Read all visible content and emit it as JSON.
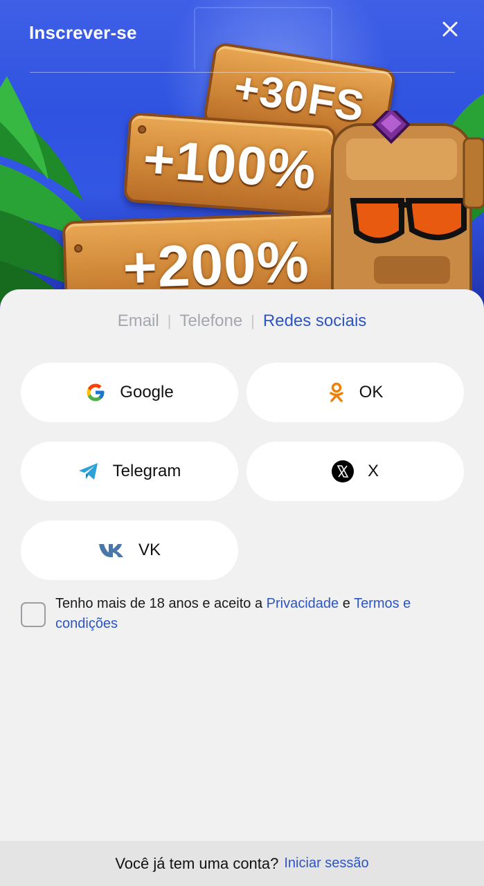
{
  "header": {
    "title": "Inscrever-se",
    "close_icon": "close-icon"
  },
  "banner": {
    "offers": [
      "+30FS",
      "+100%",
      "+200%"
    ]
  },
  "tabs": [
    {
      "label": "Email",
      "active": false
    },
    {
      "label": "Telefone",
      "active": false
    },
    {
      "label": "Redes sociais",
      "active": true
    }
  ],
  "social": [
    {
      "label": "Google",
      "icon": "google-icon"
    },
    {
      "label": "OK",
      "icon": "odnoklassniki-icon"
    },
    {
      "label": "Telegram",
      "icon": "telegram-icon"
    },
    {
      "label": "X",
      "icon": "x-icon"
    },
    {
      "label": "VK",
      "icon": "vk-icon"
    }
  ],
  "consent": {
    "checked": false,
    "text_before": "Tenho mais de 18 anos e aceito a",
    "privacy_link": "Privacidade",
    "text_and": "e",
    "terms_link": "Termos e condições"
  },
  "footer": {
    "question": "Você já tem uma conta?",
    "login_link": "Iniciar sessão"
  },
  "colors": {
    "accent": "#2c55c2",
    "banner_blue": "#3356e4",
    "sheet_bg": "#f1f1f1"
  }
}
